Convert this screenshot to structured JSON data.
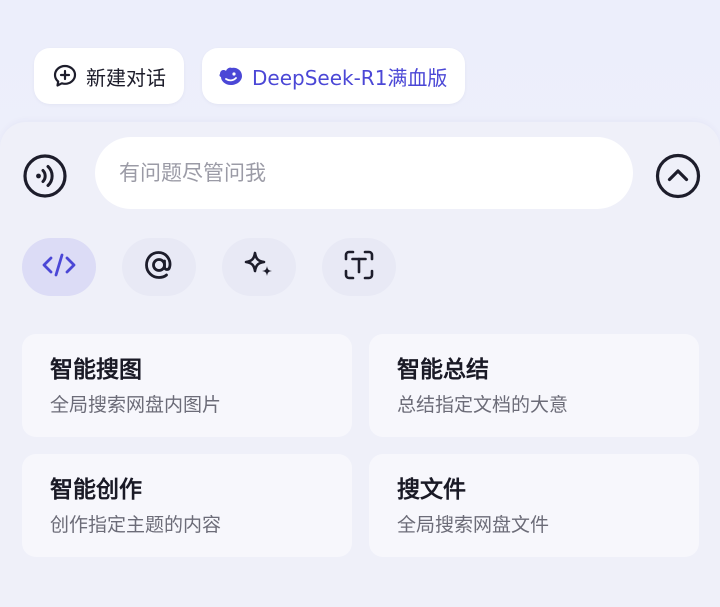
{
  "top_chips": {
    "new_chat_label": "新建对话",
    "deepseek_label": "DeepSeek-R1满血版"
  },
  "composer": {
    "placeholder": "有问题尽管问我"
  },
  "tools": [
    {
      "icon": "code-icon",
      "active": true
    },
    {
      "icon": "at-icon",
      "active": false
    },
    {
      "icon": "sparkle-icon",
      "active": false
    },
    {
      "icon": "text-scan-icon",
      "active": false
    }
  ],
  "cards": [
    {
      "title": "智能搜图",
      "subtitle": "全局搜索网盘内图片"
    },
    {
      "title": "智能总结",
      "subtitle": "总结指定文档的大意"
    },
    {
      "title": "智能创作",
      "subtitle": "创作指定主题的内容"
    },
    {
      "title": "搜文件",
      "subtitle": "全局搜索网盘文件"
    }
  ],
  "colors": {
    "accent": "#4b47d6",
    "icon_dark": "#1d1d2b"
  }
}
